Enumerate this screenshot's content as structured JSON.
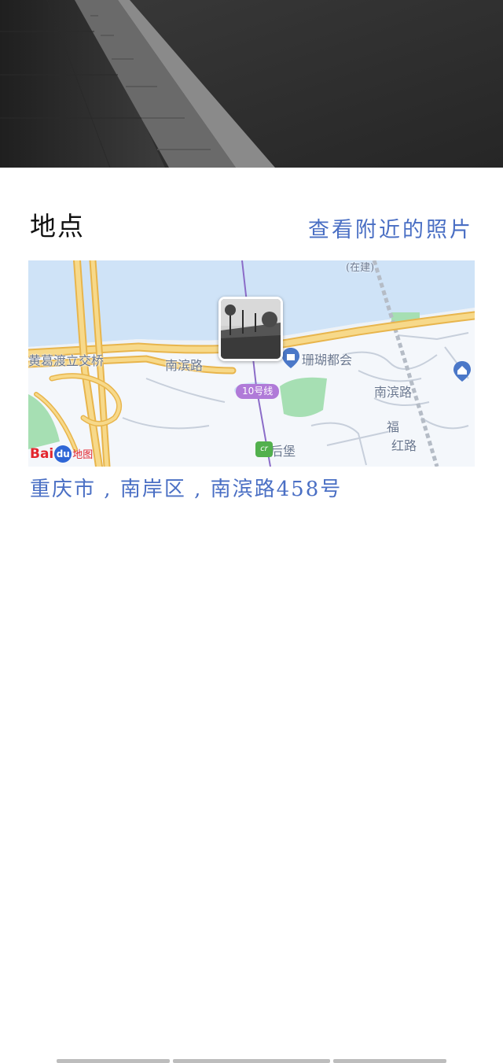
{
  "location_section": {
    "title": "地点",
    "nearby_photos_link": "查看附近的照片"
  },
  "map": {
    "provider_logo": {
      "bai": "Bai",
      "du": "du",
      "map": "地图"
    },
    "labels": {
      "interchange": "黄葛渡立交桥",
      "road_west": "南滨路",
      "poi_shanhu": "珊瑚都会",
      "road_east": "南滨路",
      "metro_line": "10号线",
      "station": "后堡",
      "road_fu": "福",
      "road_hong": "红路",
      "under_construction": "(在建)"
    },
    "colors": {
      "water": "#cfe3f7",
      "road": "#f5c96a",
      "green": "#a6dfb3",
      "metro": "#b07ad8"
    }
  },
  "address": {
    "city": "重庆市",
    "district": "南岸区",
    "street": "南滨路458号",
    "separator": " , "
  }
}
